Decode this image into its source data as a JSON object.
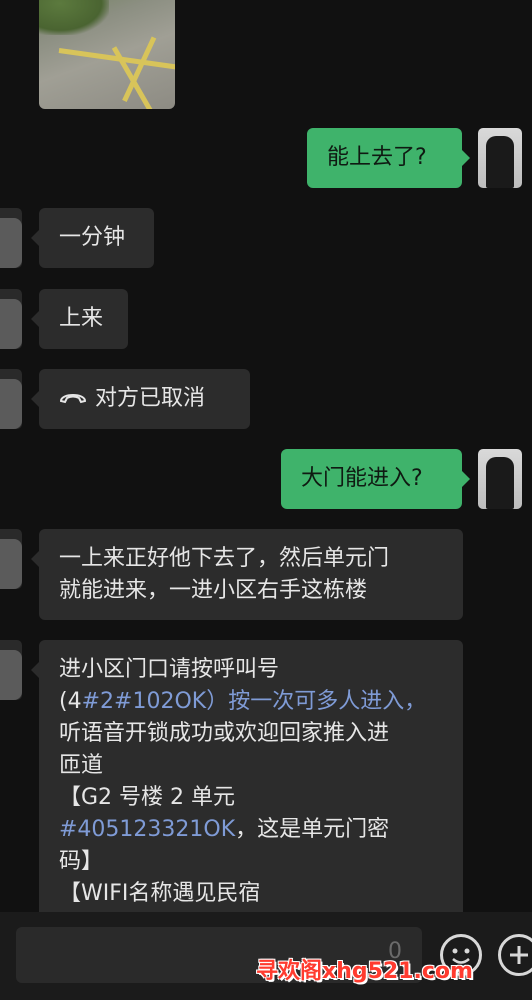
{
  "messages": [
    {
      "id": "m1",
      "side": "out",
      "text": "能上去了?"
    },
    {
      "id": "m2",
      "side": "in",
      "text": "一分钟"
    },
    {
      "id": "m3",
      "side": "in",
      "text": "上来"
    },
    {
      "id": "m4",
      "side": "in",
      "type": "call",
      "icon": "phone-hangup-icon",
      "text": "对方已取消"
    },
    {
      "id": "m5",
      "side": "out",
      "text": "大门能进入?"
    },
    {
      "id": "m6",
      "side": "in",
      "lines": [
        "一上来正好他下去了，然后单元门",
        "就能进来，一进小区右手这栋楼"
      ]
    },
    {
      "id": "m7",
      "side": "in",
      "line1": "进小区门口请按呼叫号",
      "line2_prefix": "(4",
      "line2_link": "#2#102OK",
      "line2_suffix": "）按一次可多人进入，",
      "line3": "听语音开锁成功或欢迎回家推入进",
      "line4": "匝道",
      "line5": "【G2 号楼 2 单元",
      "line6_link": "#405123321OK",
      "line6_suffix": "，这是单元门密",
      "line7": "码】",
      "line8": "【WIFI名称遇见民宿"
    }
  ],
  "input_bar": {
    "placeholder": "",
    "voice_hint": "0"
  },
  "icons": {
    "emoji": "emoji-icon",
    "add": "plus-icon"
  },
  "watermark": "寻欢阁xhg521.com",
  "colors": {
    "background": "#111111",
    "bubble_in": "#2c2c2c",
    "bubble_out": "#3fb36b",
    "link": "#7f9bd6",
    "watermark": "#ff3b2f"
  }
}
